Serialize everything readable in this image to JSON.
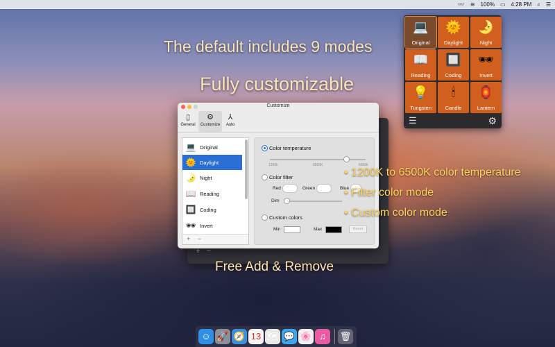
{
  "menubar": {
    "apple_glyph": "",
    "app_icon": "glasses-icon",
    "battery": "100%",
    "time": "4:28 PM"
  },
  "promo": {
    "line1": "The default includes 9 modes",
    "line2": "Fully customizable",
    "bullet1": "• 1200K to 6500K color temperature",
    "bullet2": "• Filter color mode",
    "bullet3": "• Custom color mode",
    "footer": "Free Add & Remove"
  },
  "modes": [
    {
      "label": "Original",
      "icon": "laptop-icon",
      "glyph": "💻"
    },
    {
      "label": "Daylight",
      "icon": "sun-icon",
      "glyph": "🌞"
    },
    {
      "label": "Night",
      "icon": "moon-icon",
      "glyph": "🌛"
    },
    {
      "label": "Reading",
      "icon": "book-icon",
      "glyph": "📖"
    },
    {
      "label": "Coding",
      "icon": "circuit-icon",
      "glyph": "🔲"
    },
    {
      "label": "Invert",
      "icon": "sunglasses-icon",
      "glyph": "🕶"
    },
    {
      "label": "Tungsten",
      "icon": "lightbulb-icon",
      "glyph": "💡"
    },
    {
      "label": "Candle",
      "icon": "candle-icon",
      "glyph": "🕯"
    },
    {
      "label": "Lantern",
      "icon": "lantern-icon",
      "glyph": "🏮"
    }
  ],
  "window": {
    "title": "Customize",
    "tabs": [
      {
        "label": "General",
        "icon": "phone-icon",
        "glyph": "▯"
      },
      {
        "label": "Customize",
        "icon": "gear-icon",
        "glyph": "⚙"
      },
      {
        "label": "Auto",
        "icon": "compass-icon",
        "glyph": "⅄"
      }
    ],
    "list": [
      {
        "label": "Original",
        "glyph": "💻"
      },
      {
        "label": "Daylight",
        "glyph": "🌞"
      },
      {
        "label": "Night",
        "glyph": "🌛"
      },
      {
        "label": "Reading",
        "glyph": "📖"
      },
      {
        "label": "Coding",
        "glyph": "🔲"
      },
      {
        "label": "Invert",
        "glyph": "🕶"
      }
    ],
    "add_label": "+",
    "remove_label": "−",
    "color_temperature_label": "Color temperature",
    "temp_ticks": [
      "1200k",
      "6500K",
      "6500k"
    ],
    "color_filter_label": "Color filter",
    "red_label": "Red",
    "green_label": "Green",
    "blue_label": "Blue",
    "dim_label": "Dim",
    "custom_colors_label": "Custom colors",
    "min_label": "Min",
    "max_label": "Max",
    "reset_label": "Reset"
  },
  "colors": {
    "mode_tile": "#d1601f",
    "accent": "#2a6fd6",
    "promo_text": "#fbe3b8",
    "bullet_text": "#ffd25a"
  }
}
